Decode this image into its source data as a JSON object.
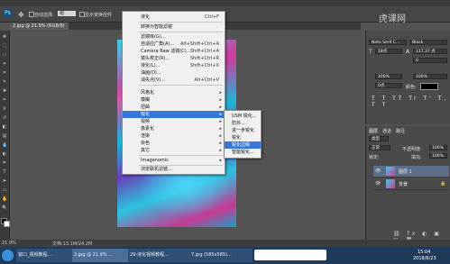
{
  "document_tab": "2.jpg @ 21.9% (RGB/8)",
  "options_bar": {
    "auto_select_label": "自动选择:",
    "layer_value": "组",
    "transform_label": "显示变换控件"
  },
  "filter_menu": {
    "items": [
      {
        "label": "液化",
        "shortcut": "Ctrl+F"
      },
      {
        "label": "转换为智能滤镜",
        "shortcut": ""
      },
      {
        "label": "滤镜库(G)...",
        "shortcut": ""
      },
      {
        "label": "自适应广角(A)...",
        "shortcut": "Alt+Shift+Ctrl+A"
      },
      {
        "label": "Camera Raw 滤镜(C)...",
        "shortcut": "Shift+Ctrl+A"
      },
      {
        "label": "镜头校正(R)...",
        "shortcut": "Shift+Ctrl+R"
      },
      {
        "label": "液化(L)...",
        "shortcut": "Shift+Ctrl+X"
      },
      {
        "label": "油画(O)...",
        "shortcut": ""
      },
      {
        "label": "消失点(V)...",
        "shortcut": "Alt+Ctrl+V"
      },
      {
        "label": "风格化",
        "shortcut": ""
      },
      {
        "label": "模糊",
        "shortcut": ""
      },
      {
        "label": "扭曲",
        "shortcut": ""
      },
      {
        "label": "锐化",
        "shortcut": ""
      },
      {
        "label": "视频",
        "shortcut": ""
      },
      {
        "label": "像素化",
        "shortcut": ""
      },
      {
        "label": "渲染",
        "shortcut": ""
      },
      {
        "label": "杂色",
        "shortcut": ""
      },
      {
        "label": "其它",
        "shortcut": ""
      },
      {
        "label": "Imagenomic",
        "shortcut": ""
      },
      {
        "label": "浏览联机滤镜...",
        "shortcut": ""
      }
    ]
  },
  "sharpen_submenu": {
    "items": [
      "USM 锐化...",
      "防抖...",
      "进一步锐化",
      "锐化",
      "锐化边缘",
      "智能锐化..."
    ]
  },
  "character_panel": {
    "font": "Noto Serif C...",
    "style": "Black",
    "size": "18点",
    "leading": "117.37 点",
    "tracking": "0",
    "scale_v": "100%",
    "scale_h": "100%",
    "baseline": "0点",
    "color_label": "颜色:"
  },
  "layers_panel": {
    "tabs": [
      "图层",
      "通道",
      "路径"
    ],
    "kind_label": "类型",
    "blend_mode": "正常",
    "opacity_label": "不透明度:",
    "opacity": "100%",
    "lock_label": "锁定:",
    "fill_label": "填充:",
    "fill": "100%",
    "layers": [
      {
        "name": "图层 1"
      },
      {
        "name": "背景"
      }
    ]
  },
  "status_bar": {
    "zoom": "21.9%",
    "doc_info": "文档:13.1M/24.2M"
  },
  "taskbar": {
    "tasks": [
      "窗口_视频教程...",
      "2.jpg @ 21.9% ...",
      "29-液化视频教程...",
      "7.jpg (585x585)..."
    ],
    "time": "15:04",
    "date": "2018/6/23"
  },
  "watermark": "虎课网"
}
